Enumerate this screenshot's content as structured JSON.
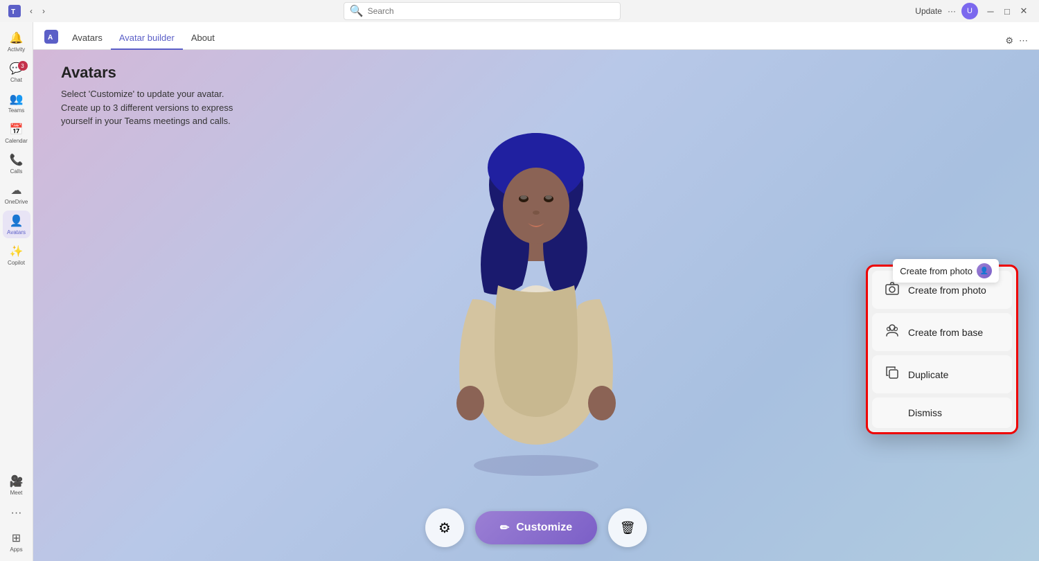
{
  "titleBar": {
    "update_label": "Update",
    "search_placeholder": "Search"
  },
  "tabs": {
    "items": [
      {
        "label": "Avatars",
        "id": "avatars"
      },
      {
        "label": "Avatar builder",
        "id": "avatar-builder"
      },
      {
        "label": "About",
        "id": "about"
      }
    ],
    "active": "avatar-builder"
  },
  "sidebar": {
    "items": [
      {
        "label": "Activity",
        "icon": "🔔",
        "id": "activity",
        "badge": null
      },
      {
        "label": "Chat",
        "icon": "💬",
        "id": "chat",
        "badge": "3"
      },
      {
        "label": "Teams",
        "icon": "👥",
        "id": "teams",
        "badge": null
      },
      {
        "label": "Calendar",
        "icon": "📅",
        "id": "calendar",
        "badge": null
      },
      {
        "label": "Calls",
        "icon": "📞",
        "id": "calls",
        "badge": null
      },
      {
        "label": "OneDrive",
        "icon": "☁",
        "id": "onedrive",
        "badge": null
      },
      {
        "label": "Avatars",
        "icon": "👤",
        "id": "avatars",
        "badge": null,
        "active": true
      },
      {
        "label": "Copilot",
        "icon": "✨",
        "id": "copilot",
        "badge": null
      },
      {
        "label": "Meet",
        "icon": "🎥",
        "id": "meet",
        "badge": null
      },
      {
        "label": "Apps",
        "icon": "⊞",
        "id": "apps",
        "badge": null
      }
    ]
  },
  "page": {
    "title": "Avatars",
    "description_line1": "Select 'Customize' to update your avatar.",
    "description_line2": "Create up to 3 different versions to express",
    "description_line3": "yourself in your Teams meetings and calls."
  },
  "buttons": {
    "customize_label": "Customize",
    "settings_icon": "⚙",
    "delete_icon": "🗑",
    "pencil_icon": "✏"
  },
  "contextMenu": {
    "tooltip_label": "Create from photo",
    "items": [
      {
        "id": "create-from-photo",
        "icon": "📷",
        "label": "Create from photo"
      },
      {
        "id": "create-from-base",
        "icon": "👤",
        "label": "Create from base"
      },
      {
        "id": "duplicate",
        "icon": "📋",
        "label": "Duplicate"
      },
      {
        "id": "dismiss",
        "icon": "",
        "label": "Dismiss"
      }
    ]
  }
}
